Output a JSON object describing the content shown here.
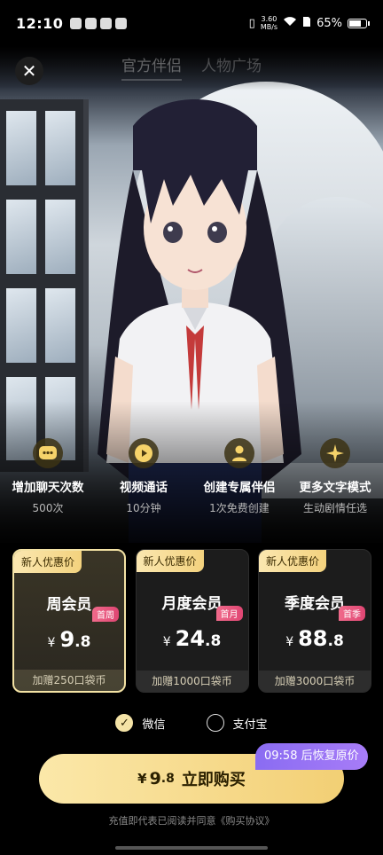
{
  "status_bar": {
    "time": "12:10",
    "net_speed": "3.60",
    "net_unit": "MB/s",
    "battery": "65%",
    "battery_level": 0.65
  },
  "tabs": [
    "官方伴侣",
    "人物广场"
  ],
  "close_label": "✕",
  "features": [
    {
      "icon": "chat-bubble-icon",
      "title": "增加聊天次数",
      "subtitle": "500次"
    },
    {
      "icon": "video-play-icon",
      "title": "视频通话",
      "subtitle": "10分钟"
    },
    {
      "icon": "companion-user-icon",
      "title": "创建专属伴侣",
      "subtitle": "1次免费创建"
    },
    {
      "icon": "sparkle-icon",
      "title": "更多文字模式",
      "subtitle": "生动剧情任选"
    }
  ],
  "plans": [
    {
      "badge": "新人优惠价",
      "name": "周会员",
      "tag": "首周",
      "currency": "¥",
      "price_int": "9",
      "price_dec": ".8",
      "bonus": "加赠250口袋币",
      "selected": true
    },
    {
      "badge": "新人优惠价",
      "name": "月度会员",
      "tag": "首月",
      "currency": "¥",
      "price_int": "24",
      "price_dec": ".8",
      "bonus": "加赠1000口袋币",
      "selected": false
    },
    {
      "badge": "新人优惠价",
      "name": "季度会员",
      "tag": "首季",
      "currency": "¥",
      "price_int": "88",
      "price_dec": ".8",
      "bonus": "加赠3000口袋币",
      "selected": false
    }
  ],
  "payment": {
    "wechat": "微信",
    "alipay": "支付宝",
    "selected": "wechat"
  },
  "buy": {
    "currency": "¥",
    "amount": "9",
    "decimal": ".8",
    "label": "立即购买"
  },
  "timer": "09:58 后恢复原价",
  "agreement": "充值即代表已阅读并同意《购买协议》",
  "colors": {
    "gold": "#f6d98a",
    "timer_purple": "#9a74f5",
    "tag_pink": "#e04673"
  }
}
